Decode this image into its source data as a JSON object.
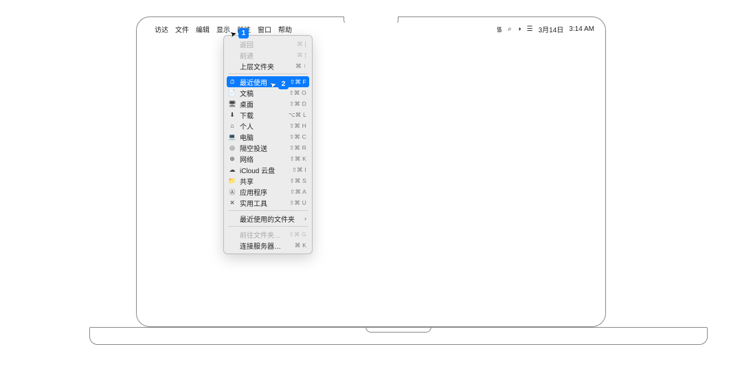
{
  "menubar": {
    "app": "访达",
    "items": [
      "文件",
      "编辑",
      "显示",
      "前往",
      "窗口",
      "帮助"
    ],
    "active_index": 3,
    "status": {
      "date": "3月14日",
      "time": "3:14 AM"
    }
  },
  "dropdown": {
    "sections": [
      [
        {
          "icon": "",
          "label": "返回",
          "shortcut": "⌘ [",
          "disabled": true
        },
        {
          "icon": "",
          "label": "前进",
          "shortcut": "⌘ ]",
          "disabled": true
        },
        {
          "icon": "",
          "label": "上层文件夹",
          "shortcut": "⌘ ↑",
          "disabled": false
        }
      ],
      [
        {
          "icon": "⏱",
          "label": "最近使用",
          "shortcut": "⇧⌘ F",
          "highlight": true
        },
        {
          "icon": "📄",
          "label": "文稿",
          "shortcut": "⇧⌘ O"
        },
        {
          "icon": "🖥",
          "label": "桌面",
          "shortcut": "⇧⌘ D"
        },
        {
          "icon": "⬇",
          "label": "下载",
          "shortcut": "⌥⌘ L"
        },
        {
          "icon": "⌂",
          "label": "个人",
          "shortcut": "⇧⌘ H"
        },
        {
          "icon": "💻",
          "label": "电脑",
          "shortcut": "⇧⌘ C"
        },
        {
          "icon": "◎",
          "label": "隔空投送",
          "shortcut": "⇧⌘ R"
        },
        {
          "icon": "⊕",
          "label": "网络",
          "shortcut": "⇧⌘ K"
        },
        {
          "icon": "☁",
          "label": "iCloud 云盘",
          "shortcut": "⇧⌘ I"
        },
        {
          "icon": "📁",
          "label": "共享",
          "shortcut": "⇧⌘ S"
        },
        {
          "icon": "Ⓐ",
          "label": "应用程序",
          "shortcut": "⇧⌘ A"
        },
        {
          "icon": "✕",
          "label": "实用工具",
          "shortcut": "⇧⌘ U"
        }
      ],
      [
        {
          "icon": "",
          "label": "最近使用的文件夹",
          "submenu": true
        }
      ],
      [
        {
          "icon": "",
          "label": "前往文件夹…",
          "shortcut": "⇧⌘ G",
          "disabled": true
        },
        {
          "icon": "",
          "label": "连接服务器…",
          "shortcut": "⌘ K"
        }
      ]
    ]
  },
  "badges": {
    "one": "1",
    "two": "2"
  }
}
